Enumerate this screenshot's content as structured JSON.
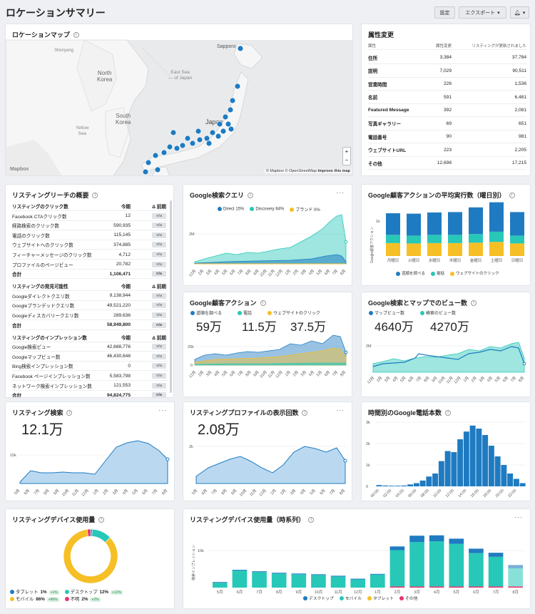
{
  "page": {
    "title": "ロケーションサマリー",
    "settings": "設定",
    "export": "エクスポート",
    "bell": "bell-icon"
  },
  "colors": {
    "blue": "#1f7bc1",
    "teal": "#27c8b8",
    "yellow": "#f6bf26",
    "pink": "#e8336b",
    "green": "#3cb371"
  },
  "map": {
    "title": "ロケーションマップ",
    "labels": {
      "sapporo": "Sapporo",
      "japan": "Japan",
      "north_korea": "North\nKorea",
      "south_korea": "South\nKorea",
      "east_sea": "East Sea\n— of Japan",
      "yellow_sea": "Yellow\nSea",
      "shenyang": "Shenyang"
    },
    "attribution": "© Mapbox © OpenStreetMap",
    "improve": "Improve this map",
    "logo": "Mapbox",
    "zoom_in": "+",
    "zoom_out": "−"
  },
  "attr": {
    "title": "属性変更",
    "head": [
      "属性",
      "属性変更",
      "リスティングが更新されました"
    ],
    "rows": [
      [
        "住所",
        "3,384",
        "37,784"
      ],
      [
        "説明",
        "7,029",
        "90,511"
      ],
      [
        "営業時間",
        "226",
        "1,536"
      ],
      [
        "名前",
        "591",
        "6,481"
      ],
      [
        "Featured Message",
        "392",
        "2,081"
      ],
      [
        "写真ギャラリー",
        "69",
        "651"
      ],
      [
        "電話番号",
        "90",
        "981"
      ],
      [
        "ウェブサイトURL",
        "223",
        "2,205"
      ],
      [
        "その他",
        "12,698",
        "17,215"
      ]
    ]
  },
  "reach": {
    "title": "リスティングリーチの概要",
    "sections": [
      {
        "head": "リスティングのクリック数",
        "c2": "今期",
        "c3": "Δ 前期",
        "rows": [
          [
            "Facebook CTAクリック数",
            "12"
          ],
          [
            "経路検索のクリック数",
            "590,935"
          ],
          [
            "電話のクリック数",
            "115,145"
          ],
          [
            "ウェブサイトへのクリック数",
            "374,885"
          ],
          [
            "フィーチャーメッセージのクリック数",
            "4,712"
          ],
          [
            "プロファイルのページビュー",
            "20,782"
          ]
        ],
        "total_label": "合計",
        "total": "1,106,471"
      },
      {
        "head": "リスティングの発見可能性",
        "c2": "今期",
        "c3": "Δ 前期",
        "rows": [
          [
            "Googleダイレクトクエリ数",
            "9,138,944"
          ],
          [
            "Googleブランデッドクエリ数",
            "49,521,220"
          ],
          [
            "Googleディスカバリークエリ数",
            "289,636"
          ]
        ],
        "total_label": "合計",
        "total": "58,949,800"
      },
      {
        "head": "リスティングのインプレッション数",
        "c2": "今期",
        "c3": "Δ 前期",
        "rows": [
          [
            "Google検索ビュー",
            "42,688,776"
          ],
          [
            "Googleマップビュー数",
            "46,430,648"
          ],
          [
            "Bing検索インプレッション数",
            "0"
          ],
          [
            "Facebook ページインプレッション数",
            "5,583,798"
          ],
          [
            "ネットワーク検索インプレッション数",
            "121,553"
          ]
        ],
        "total_label": "合計",
        "total": "94,824,775"
      }
    ],
    "na": "n/a"
  },
  "gq": {
    "title": "Google検索クエリ",
    "legend": [
      "Direct 15%",
      "Discovery 84%",
      "ブランド 0%"
    ],
    "ytick": "2M",
    "x": [
      "12月",
      "2月",
      "3月",
      "4月",
      "5月",
      "6月",
      "7月",
      "8月",
      "9月",
      "10月",
      "11月",
      "12月",
      "1月",
      "2月",
      "3月",
      "4月",
      "5月",
      "6月",
      "7月",
      "8月"
    ]
  },
  "dow": {
    "title": "Google顧客アクションの平均実行数（曜日別）",
    "ylabel": "Google顧客アクション",
    "ytick": "1k",
    "days": [
      "月曜日",
      "火曜日",
      "水曜日",
      "木曜日",
      "金曜日",
      "土曜日",
      "日曜日"
    ],
    "legend": [
      "道順を調べる",
      "電話",
      "ウェブサイトのクリック"
    ],
    "chart_data": {
      "type": "bar",
      "categories": [
        "月曜日",
        "火曜日",
        "水曜日",
        "木曜日",
        "金曜日",
        "土曜日",
        "日曜日"
      ],
      "series": [
        {
          "name": "道順を調べる",
          "values": [
            550,
            560,
            570,
            580,
            680,
            750,
            600
          ]
        },
        {
          "name": "電話",
          "values": [
            210,
            200,
            210,
            210,
            220,
            260,
            200
          ]
        },
        {
          "name": "ウェブサイトのクリック",
          "values": [
            330,
            320,
            330,
            330,
            340,
            360,
            320
          ]
        }
      ]
    }
  },
  "gca": {
    "title": "Google顧客アクション",
    "legend": [
      "道順を調べる",
      "電話",
      "ウェブサイトのクリック"
    ],
    "kpis": [
      "59万",
      "11.5万",
      "37.5万"
    ],
    "ytick": "20k",
    "ytick2": "0"
  },
  "gsm": {
    "title": "Google検索とマップでのビュー数",
    "legend": [
      "マップビュー数",
      "検索のビュー数"
    ],
    "kpis": [
      "4640万",
      "4270万"
    ],
    "ytick": "2M"
  },
  "ls": {
    "title": "リスティング検索",
    "kpi": "12.1万",
    "ytick": "10k"
  },
  "lp": {
    "title": "リスティングプロファイルの表示回数",
    "kpi": "2.08万",
    "ytick": "2k"
  },
  "x13": [
    "5月",
    "6月",
    "7月",
    "8月",
    "9月",
    "10月",
    "11月",
    "12月",
    "1月",
    "2月",
    "3月",
    "4月",
    "5月",
    "6月",
    "7月",
    "8月"
  ],
  "calls": {
    "title": "時間別のGoogle電話本数",
    "yticks": [
      "3k",
      "2k",
      "1k",
      "0"
    ],
    "xticks": [
      "00:00",
      "02:00",
      "04:00",
      "06:00",
      "08:00",
      "10:00",
      "12:00",
      "14:00",
      "16:00",
      "18:00",
      "20:00",
      "22:00"
    ],
    "chart_data": {
      "type": "bar",
      "x": [
        "00:00",
        "01:00",
        "02:00",
        "03:00",
        "04:00",
        "05:00",
        "06:00",
        "07:00",
        "08:00",
        "09:00",
        "10:00",
        "11:00",
        "12:00",
        "13:00",
        "14:00",
        "15:00",
        "16:00",
        "17:00",
        "18:00",
        "19:00",
        "20:00",
        "21:00",
        "22:00",
        "23:00"
      ],
      "values": [
        60,
        40,
        30,
        30,
        40,
        90,
        150,
        270,
        460,
        600,
        1180,
        1650,
        1600,
        2200,
        2560,
        2840,
        2700,
        2400,
        1900,
        1400,
        1000,
        600,
        350,
        150
      ],
      "ylim": [
        0,
        3000
      ]
    }
  },
  "dev": {
    "title": "リスティングデバイス使用量",
    "legend": [
      [
        "タブレット",
        "1%",
        "+1%"
      ],
      [
        "デスクトップ",
        "12%",
        "+12%"
      ],
      [
        "モバイル",
        "86%",
        "+86%"
      ],
      [
        "不明",
        "2%",
        "+2%"
      ]
    ],
    "chart_data": {
      "type": "pie",
      "labels": [
        "タブレット",
        "デスクトップ",
        "モバイル",
        "不明"
      ],
      "values": [
        1,
        12,
        86,
        2
      ]
    }
  },
  "devts": {
    "title": "リスティングデバイス使用量（時系列）",
    "ylabel": "検索インプレッション",
    "ytick": "10k",
    "legend": [
      "デスクトップ",
      "モバイル",
      "タブレット",
      "その他"
    ],
    "x": [
      "5月",
      "6月",
      "7月",
      "8月",
      "9月",
      "10月",
      "11月",
      "12月",
      "1月",
      "2月",
      "3月",
      "4月",
      "5月",
      "6月",
      "7月",
      "8月"
    ],
    "chart_data": {
      "type": "bar",
      "categories": [
        "5月",
        "6月",
        "7月",
        "8月",
        "9月",
        "10月",
        "11月",
        "12月",
        "1月",
        "2月",
        "3月",
        "4月",
        "5月",
        "6月",
        "7月",
        "8月"
      ],
      "series": [
        {
          "name": "デスクトップ",
          "values": [
            200,
            200,
            200,
            200,
            200,
            200,
            200,
            200,
            200,
            1000,
            1700,
            1600,
            1400,
            1200,
            1100,
            900
          ]
        },
        {
          "name": "モバイル",
          "values": [
            1300,
            4600,
            4200,
            3800,
            3600,
            3400,
            3000,
            2200,
            3500,
            9800,
            12000,
            12200,
            11500,
            9000,
            8000,
            4900
          ]
        },
        {
          "name": "その他",
          "values": [
            0,
            0,
            0,
            0,
            0,
            0,
            0,
            0,
            0,
            300,
            300,
            300,
            300,
            300,
            300,
            300
          ]
        }
      ]
    }
  }
}
